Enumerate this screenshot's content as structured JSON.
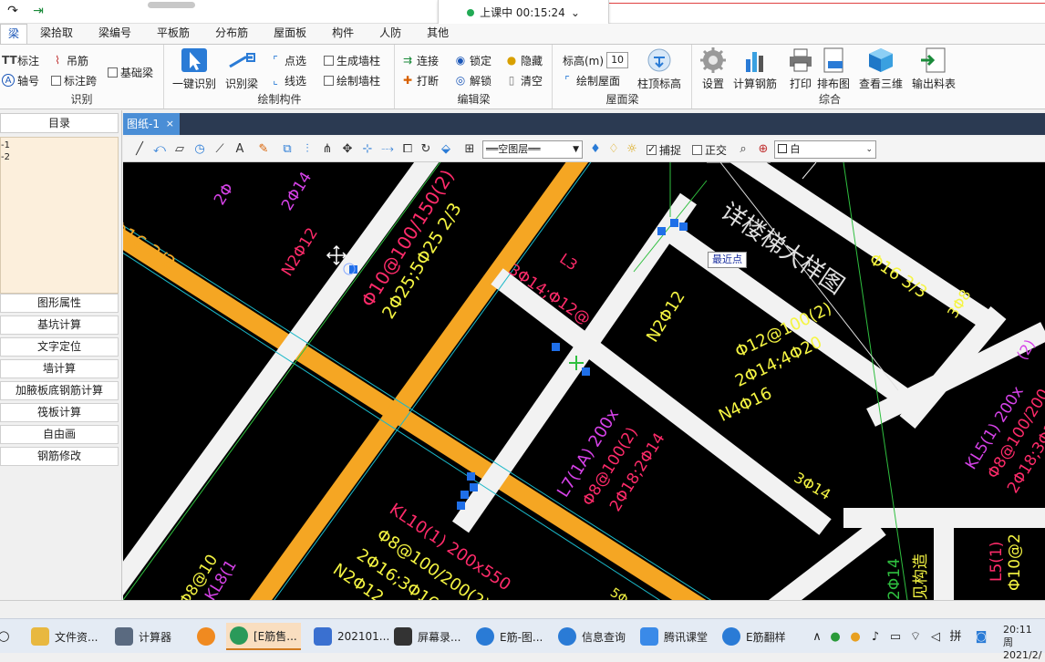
{
  "titlebar": {
    "qa_icons": [
      "redo-arrow-icon",
      "export-icon"
    ]
  },
  "class_timer": {
    "status": "上课中 00:15:24",
    "chevron": "⌄"
  },
  "menu": {
    "tabs": [
      "梁",
      "梁拾取",
      "梁编号",
      "平板筋",
      "分布筋",
      "屋面板",
      "构件",
      "人防",
      "其他"
    ]
  },
  "ribbon": {
    "groups": {
      "identify": {
        "label": "识别",
        "items": [
          "标注",
          "吊筋",
          "基础梁",
          "轴号",
          "标注跨"
        ]
      },
      "draw": {
        "label": "绘制构件",
        "big": [
          "一键识别",
          "识别梁"
        ],
        "items": [
          "点选",
          "生成墙柱",
          "线选",
          "绘制墙柱"
        ]
      },
      "edit": {
        "label": "编辑梁",
        "items": [
          "连接",
          "锁定",
          "隐藏",
          "打断",
          "解锁",
          "清空"
        ]
      },
      "roof": {
        "label": "屋面梁",
        "height_label": "标高(m)",
        "height_value": "10",
        "draw_roof": "绘制屋面",
        "top_elev": "柱顶标高"
      },
      "combined": {
        "label": "综合",
        "big": [
          "设置",
          "计算钢筋",
          "打印",
          "排布图",
          "查看三维",
          "输出料表"
        ]
      }
    }
  },
  "left": {
    "dir_header": "目录",
    "tree": [
      "-1",
      "-2"
    ],
    "buttons": [
      "图形属性",
      "基坑计算",
      "文字定位",
      "墙计算",
      "加腋板底钢筋计算",
      "筏板计算",
      "自由画",
      "钢筋修改"
    ]
  },
  "doc": {
    "tab": "图纸-1",
    "close": "×"
  },
  "drawbar": {
    "layer": "══空图层══",
    "snap": "捕捉",
    "ortho": "正交",
    "color": "白"
  },
  "canvas": {
    "tooltip": "最近点",
    "annotations": {
      "a1": "Φ16 3/2",
      "a2": "Φ10@100/150(2)",
      "a3": "2Φ25;5Φ25 2/3",
      "a4": "N2Φ12",
      "a5": "3Φ14;Φ12@",
      "a6": "N2Φ12",
      "a7": "Φ12@100(2)",
      "a8": "2Φ14;4Φ20",
      "a9": "N4Φ16",
      "a10": "L7(1A) 200x",
      "a11": "Φ8@100(2)",
      "a12": "2Φ18;2Φ14",
      "a13": "KL10(1) 200x550",
      "a14": "Φ8@100/200(2)",
      "a15": "2Φ16;3Φ16",
      "a16": "N2Φ12",
      "a17": "KL5(1) 200x",
      "a18": "Φ8@100/200",
      "a19": "2Φ18;3Φ20",
      "a20": "L5(1)",
      "a21": "Φ10@2",
      "a22": "2Φ14",
      "a23": "见构造",
      "a24": "详楼梯大样图",
      "a25": "Φ16 3/3",
      "a26": "3Φ14",
      "a27": "KL8(1",
      "a28": "Φ8@10",
      "a29": "2Φ14",
      "a30": "2Φ",
      "a31": "L3",
      "a32": "3Φ8",
      "a33": "(2)",
      "a34": "5Φ"
    }
  },
  "taskbar": {
    "tasks": [
      "文件资...",
      "计算器",
      "",
      "[E筋售...",
      "202101...",
      "屏幕录...",
      "E筋-图...",
      "信息查询",
      "腾讯课堂",
      "E筋翻样"
    ],
    "time": "20:11 周",
    "date": "2021/2/"
  }
}
